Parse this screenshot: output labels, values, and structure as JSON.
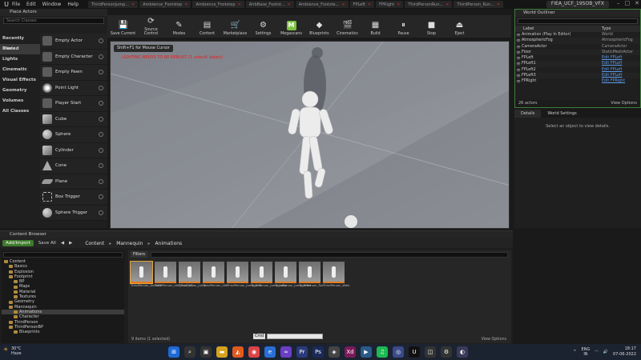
{
  "window": {
    "menu": [
      "File",
      "Edit",
      "Window",
      "Help"
    ],
    "tabs": [
      "ThirdPersonJump...",
      "Ambience_Footstep",
      "Ambience_Footstep",
      "AirbBase_Footst...",
      "Ambience_Footste...",
      "FPLeft",
      "FPRight",
      "ThirdPersonRun...",
      "ThirdPerson_Run..."
    ],
    "project": "FIEA_UCF_19SOB_VFX",
    "ddc_label": "DDC"
  },
  "place_actors": {
    "title": "Place Actors",
    "search_placeholder": "Search Classes",
    "categories": [
      "Recently Placed",
      "Basic",
      "Lights",
      "Cinematic",
      "Visual Effects",
      "Geometry",
      "Volumes",
      "All Classes"
    ],
    "selected_category": "Basic",
    "items": [
      {
        "label": "Empty Actor",
        "icon": "empty-actor-icon"
      },
      {
        "label": "Empty Character",
        "icon": "empty-character-icon"
      },
      {
        "label": "Empty Pawn",
        "icon": "empty-pawn-icon"
      },
      {
        "label": "Point Light",
        "icon": "point-light-icon"
      },
      {
        "label": "Player Start",
        "icon": "player-start-icon"
      },
      {
        "label": "Cube",
        "icon": "cube-icon"
      },
      {
        "label": "Sphere",
        "icon": "sphere-icon"
      },
      {
        "label": "Cylinder",
        "icon": "cylinder-icon"
      },
      {
        "label": "Cone",
        "icon": "cone-icon"
      },
      {
        "label": "Plane",
        "icon": "plane-icon"
      },
      {
        "label": "Box Trigger",
        "icon": "box-trigger-icon"
      },
      {
        "label": "Sphere Trigger",
        "icon": "sphere-trigger-icon"
      }
    ]
  },
  "toolbar": {
    "buttons": [
      {
        "label": "Save Current",
        "glyph": "💾"
      },
      {
        "label": "Source Control",
        "glyph": "⟳"
      },
      {
        "label": "Modes",
        "glyph": "✎"
      },
      {
        "label": "Content",
        "glyph": "▤"
      },
      {
        "label": "Marketplace",
        "glyph": "🛒"
      },
      {
        "label": "Settings",
        "glyph": "⚙"
      },
      {
        "label": "Megascans",
        "glyph": "M"
      },
      {
        "label": "Blueprints",
        "glyph": "◆"
      },
      {
        "label": "Cinematics",
        "glyph": "🎬"
      },
      {
        "label": "Build",
        "glyph": "▦"
      },
      {
        "label": "Pause",
        "glyph": "⏸"
      },
      {
        "label": "Stop",
        "glyph": "■"
      },
      {
        "label": "Eject",
        "glyph": "⏏"
      }
    ]
  },
  "viewport": {
    "hint": "Shift+F1 for Mouse Cursor",
    "warning": "LIGHTING NEEDS TO BE REBUILT (1 unbuilt object)"
  },
  "outliner": {
    "title": "World Outliner",
    "columns": [
      "Label",
      "Type"
    ],
    "rows": [
      {
        "label": "Animation (Play In Editor)",
        "type": "World",
        "link": false
      },
      {
        "label": "AtmosphericFog",
        "type": "AtmosphericFog",
        "link": false
      },
      {
        "label": "CameraActor",
        "type": "CameraActor",
        "link": false
      },
      {
        "label": "Floor",
        "type": "StaticMeshActor",
        "link": false
      },
      {
        "label": "FPLeft",
        "type": "Edit FPLeft",
        "link": true
      },
      {
        "label": "FPLeft1",
        "type": "Edit FPLeft",
        "link": true
      },
      {
        "label": "FPLeft2",
        "type": "Edit FPLeft",
        "link": true
      },
      {
        "label": "FPLeft3",
        "type": "Edit FPLeft",
        "link": true
      },
      {
        "label": "FPRight",
        "type": "Edit FPRight",
        "link": true
      }
    ],
    "count": "26 actors",
    "view_options": "View Options"
  },
  "details": {
    "tabs": [
      "Details",
      "World Settings"
    ],
    "empty_message": "Select an object to view details."
  },
  "content_browser": {
    "tab": "Content Browser",
    "add_import": "Add/Import",
    "save_all": "Save All",
    "breadcrumb": [
      "Content",
      "Mannequin",
      "Animations"
    ],
    "tree": [
      {
        "label": "Content",
        "indent": 0,
        "sel": false
      },
      {
        "label": "Basics",
        "indent": 1,
        "sel": false
      },
      {
        "label": "Explosion",
        "indent": 1,
        "sel": false
      },
      {
        "label": "Footprint",
        "indent": 1,
        "sel": false
      },
      {
        "label": "BP",
        "indent": 2,
        "sel": false
      },
      {
        "label": "Maps",
        "indent": 2,
        "sel": false
      },
      {
        "label": "Material",
        "indent": 2,
        "sel": false
      },
      {
        "label": "Textures",
        "indent": 2,
        "sel": false
      },
      {
        "label": "Geometry",
        "indent": 1,
        "sel": false
      },
      {
        "label": "Mannequin",
        "indent": 1,
        "sel": false
      },
      {
        "label": "Animations",
        "indent": 2,
        "sel": true
      },
      {
        "label": "Character",
        "indent": 2,
        "sel": false
      },
      {
        "label": "ThirdPerson",
        "indent": 1,
        "sel": false
      },
      {
        "label": "ThirdPersonBP",
        "indent": 1,
        "sel": false
      },
      {
        "label": "Blueprints",
        "indent": 2,
        "sel": false
      }
    ],
    "filters": "Filters",
    "search_placeholder": "Search Animations",
    "assets": [
      "ThirdPerson_AnimBP",
      "ThirdPerson_Idle_Run_2D",
      "ThirdPerson_Jump",
      "ThirdPerson_Idle",
      "ThirdPerson_Jump_End",
      "ThirdPerson_Jump_Loop",
      "ThirdPerson_Jump_Start",
      "ThirdPerson_Run",
      "ThirdPerson_Walk"
    ],
    "status": "9 items (1 selected)",
    "view_options": "View Options",
    "cmd_label": "Cmd",
    "cmd_placeholder": "Enter Console Command"
  },
  "taskbar": {
    "temp": "30°C",
    "weather": "Haze",
    "lang": "ENG",
    "region": "IN",
    "time": "18:17",
    "date": "07-06-2022"
  }
}
